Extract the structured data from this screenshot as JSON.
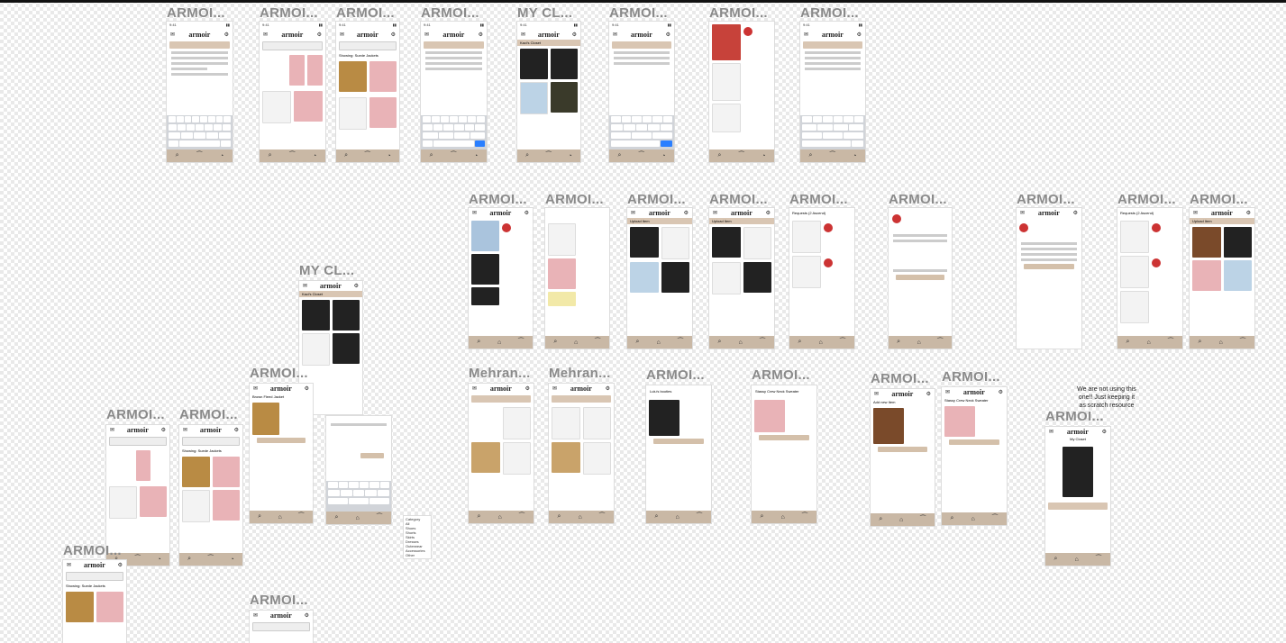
{
  "labels": {
    "armoi": "ARMOI...",
    "mycl": "MY CL...",
    "mehran": "Mehran..."
  },
  "note": {
    "line1": "We are not using this",
    "line2": "one!! Just keeping it",
    "line3": "as scratch resource"
  },
  "app": {
    "logo": "armoir",
    "closet_title": "Kaci's Closet",
    "upload": "Upload Item",
    "my_closet": "My Closet",
    "search": "Search",
    "showing": "Showing: Suede Jackets",
    "profile_settings": "Profile Settings",
    "requests": "Requests (2 Ascend)",
    "add_new_item": "Add new Item",
    "add_item_btn": "Add Item",
    "request_item": "Request Item",
    "purchase_online": "Purchase Online",
    "brown_jacket": "Brown Fleed Jacket",
    "stassy_sweater": "Stassy Crew Neck Sweater",
    "lulus_booties": "Lulu's booties"
  },
  "category_list": [
    "Category",
    "All",
    "Shoes",
    "Shorts",
    "Skirts",
    "Dresses",
    "Outerwear",
    "Shoes",
    "Accessories",
    "Other"
  ],
  "icons": {
    "search": "⌕",
    "closet": "⌂",
    "hanger": "⏜",
    "bell": "◔"
  },
  "colors": {
    "brand_tan": "#c9b8a5",
    "pink": "#e9b3b7",
    "red": "#c33"
  }
}
